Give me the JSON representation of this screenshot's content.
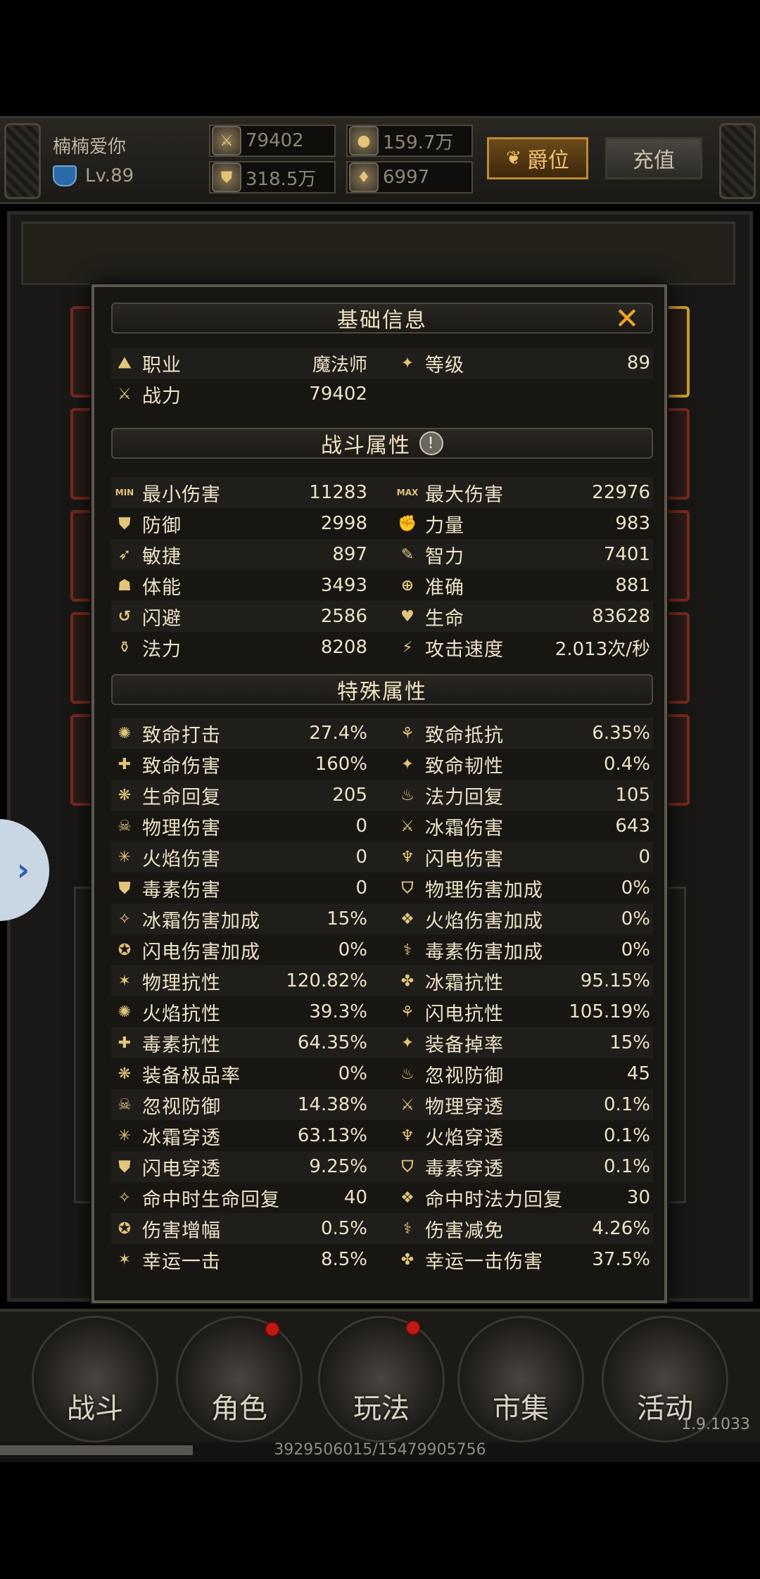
{
  "header": {
    "player_name": "楠楠爱你",
    "level": "Lv.89",
    "resources": {
      "combat_power": "79402",
      "gold": "159.7万",
      "armor_value": "318.5万",
      "gems": "6997"
    },
    "buttons": {
      "rank": "爵位",
      "recharge": "充值"
    }
  },
  "modal": {
    "basic_title": "基础信息",
    "basic_info": [
      {
        "label": "职业",
        "value": "魔法师"
      },
      {
        "label": "等级",
        "value": "89"
      },
      {
        "label": "战力",
        "value": "79402"
      }
    ],
    "combat_title": "战斗属性",
    "combat_rows": [
      [
        {
          "label": "最小伤害",
          "value": "11283",
          "icon": "MIN"
        },
        {
          "label": "最大伤害",
          "value": "22976",
          "icon": "MAX"
        }
      ],
      [
        {
          "label": "防御",
          "value": "2998",
          "icon": "⛊"
        },
        {
          "label": "力量",
          "value": "983",
          "icon": "✊"
        }
      ],
      [
        {
          "label": "敏捷",
          "value": "897",
          "icon": "➶"
        },
        {
          "label": "智力",
          "value": "7401",
          "icon": "✎"
        }
      ],
      [
        {
          "label": "体能",
          "value": "3493",
          "icon": "☗"
        },
        {
          "label": "准确",
          "value": "881",
          "icon": "⊕"
        }
      ],
      [
        {
          "label": "闪避",
          "value": "2586",
          "icon": "↺"
        },
        {
          "label": "生命",
          "value": "83628",
          "icon": "♥"
        }
      ],
      [
        {
          "label": "法力",
          "value": "8208",
          "icon": "⚱"
        },
        {
          "label": "攻击速度",
          "value": "2.013次/秒",
          "icon": "⚡"
        }
      ]
    ],
    "special_title": "特殊属性",
    "special_rows": [
      [
        {
          "label": "致命打击",
          "value": "27.4%"
        },
        {
          "label": "致命抵抗",
          "value": "6.35%"
        }
      ],
      [
        {
          "label": "致命伤害",
          "value": "160%"
        },
        {
          "label": "致命韧性",
          "value": "0.4%"
        }
      ],
      [
        {
          "label": "生命回复",
          "value": "205"
        },
        {
          "label": "法力回复",
          "value": "105"
        }
      ],
      [
        {
          "label": "物理伤害",
          "value": "0"
        },
        {
          "label": "冰霜伤害",
          "value": "643"
        }
      ],
      [
        {
          "label": "火焰伤害",
          "value": "0"
        },
        {
          "label": "闪电伤害",
          "value": "0"
        }
      ],
      [
        {
          "label": "毒素伤害",
          "value": "0"
        },
        {
          "label": "物理伤害加成",
          "value": "0%"
        }
      ],
      [
        {
          "label": "冰霜伤害加成",
          "value": "15%"
        },
        {
          "label": "火焰伤害加成",
          "value": "0%"
        }
      ],
      [
        {
          "label": "闪电伤害加成",
          "value": "0%"
        },
        {
          "label": "毒素伤害加成",
          "value": "0%"
        }
      ],
      [
        {
          "label": "物理抗性",
          "value": "120.82%"
        },
        {
          "label": "冰霜抗性",
          "value": "95.15%"
        }
      ],
      [
        {
          "label": "火焰抗性",
          "value": "39.3%"
        },
        {
          "label": "闪电抗性",
          "value": "105.19%"
        }
      ],
      [
        {
          "label": "毒素抗性",
          "value": "64.35%"
        },
        {
          "label": "装备掉率",
          "value": "15%"
        }
      ],
      [
        {
          "label": "装备极品率",
          "value": "0%"
        },
        {
          "label": "忽视防御",
          "value": "45"
        }
      ],
      [
        {
          "label": "忽视防御",
          "value": "14.38%"
        },
        {
          "label": "物理穿透",
          "value": "0.1%"
        }
      ],
      [
        {
          "label": "冰霜穿透",
          "value": "63.13%"
        },
        {
          "label": "火焰穿透",
          "value": "0.1%"
        }
      ],
      [
        {
          "label": "闪电穿透",
          "value": "9.25%"
        },
        {
          "label": "毒素穿透",
          "value": "0.1%"
        }
      ],
      [
        {
          "label": "命中时生命回复",
          "value": "40"
        },
        {
          "label": "命中时法力回复",
          "value": "30"
        }
      ],
      [
        {
          "label": "伤害增幅",
          "value": "0.5%"
        },
        {
          "label": "伤害减免",
          "value": "4.26%"
        }
      ],
      [
        {
          "label": "幸运一击",
          "value": "8.5%"
        },
        {
          "label": "幸运一击伤害",
          "value": "37.5%"
        }
      ]
    ]
  },
  "nav": {
    "items": [
      "战斗",
      "角色",
      "玩法",
      "市集",
      "活动"
    ]
  },
  "version": "1.9.1033",
  "progress": {
    "text": "3929506015/15479905756",
    "fraction": 0.254
  },
  "colors": {
    "accent": "#f0a323",
    "text": "#eee2c6",
    "panel": "#171613"
  }
}
